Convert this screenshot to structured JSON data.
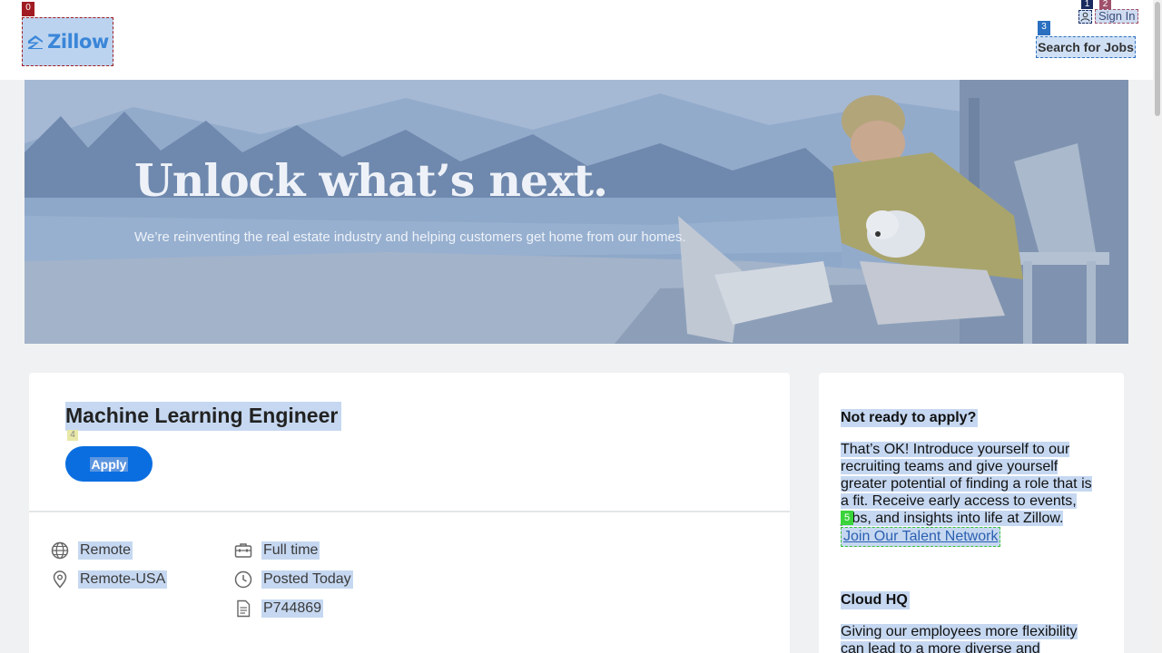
{
  "header": {
    "logo_text": "Zillow",
    "sign_in": "Sign In",
    "search_jobs": "Search for Jobs"
  },
  "hero": {
    "title": "Unlock what’s next.",
    "subtitle": "We’re reinventing the real estate industry and helping customers get home from our homes."
  },
  "job": {
    "title": "Machine Learning Engineer",
    "apply_label": "Apply",
    "meta": {
      "location_type": "Remote",
      "location": "Remote-USA",
      "employment": "Full time",
      "posted": "Posted Today",
      "requisition": "P744869"
    }
  },
  "sidebar": {
    "heading1": "Not ready to apply?",
    "para1_lines": [
      "That’s OK! Introduce yourself to our",
      "recruiting teams and give yourself",
      "greater potential of finding a role that is",
      "a fit. Receive early access to events,",
      "jobs, and insights into life at Zillow."
    ],
    "link": "Join Our Talent Network",
    "heading2": "Cloud HQ",
    "para2_lines": [
      "Giving our employees more flexibility",
      "can lead to a more diverse and"
    ]
  },
  "annotation_tags": [
    "0",
    "1",
    "2",
    "3",
    "4",
    "5"
  ],
  "colors": {
    "brand_blue": "#0a6ee0",
    "highlight": "#c6d8f1"
  },
  "icons": {
    "location_type": "globe-icon",
    "location": "map-pin-icon",
    "employment": "briefcase-icon",
    "posted": "clock-icon",
    "requisition": "document-icon"
  }
}
